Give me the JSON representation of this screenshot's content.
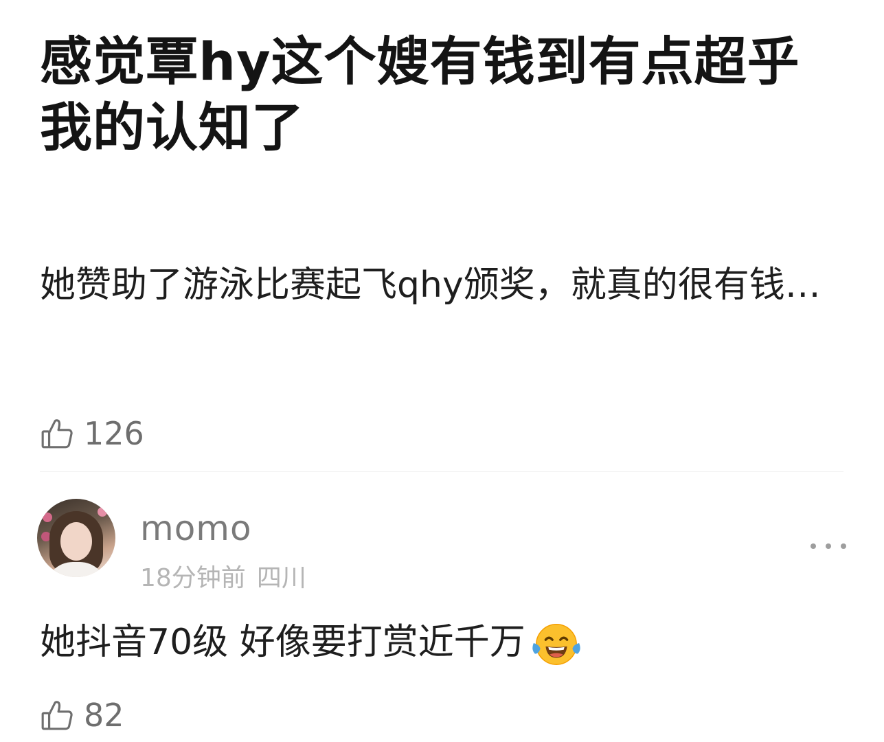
{
  "post": {
    "title": "感觉覃hy这个嫂有钱到有点超乎我的认知了",
    "body": "她赞助了游泳比赛起飞qhy颁奖，就真的很有钱…",
    "like_count": "126"
  },
  "comment": {
    "username": "momo",
    "time": "18分钟前",
    "location": "四川",
    "text": "她抖音70级 好像要打赏近千万",
    "emoji": "face-with-tears-of-joy-emoji",
    "like_count": "82"
  },
  "icons": {
    "like": "thumbs-up-icon",
    "more": "more-dots-icon"
  }
}
